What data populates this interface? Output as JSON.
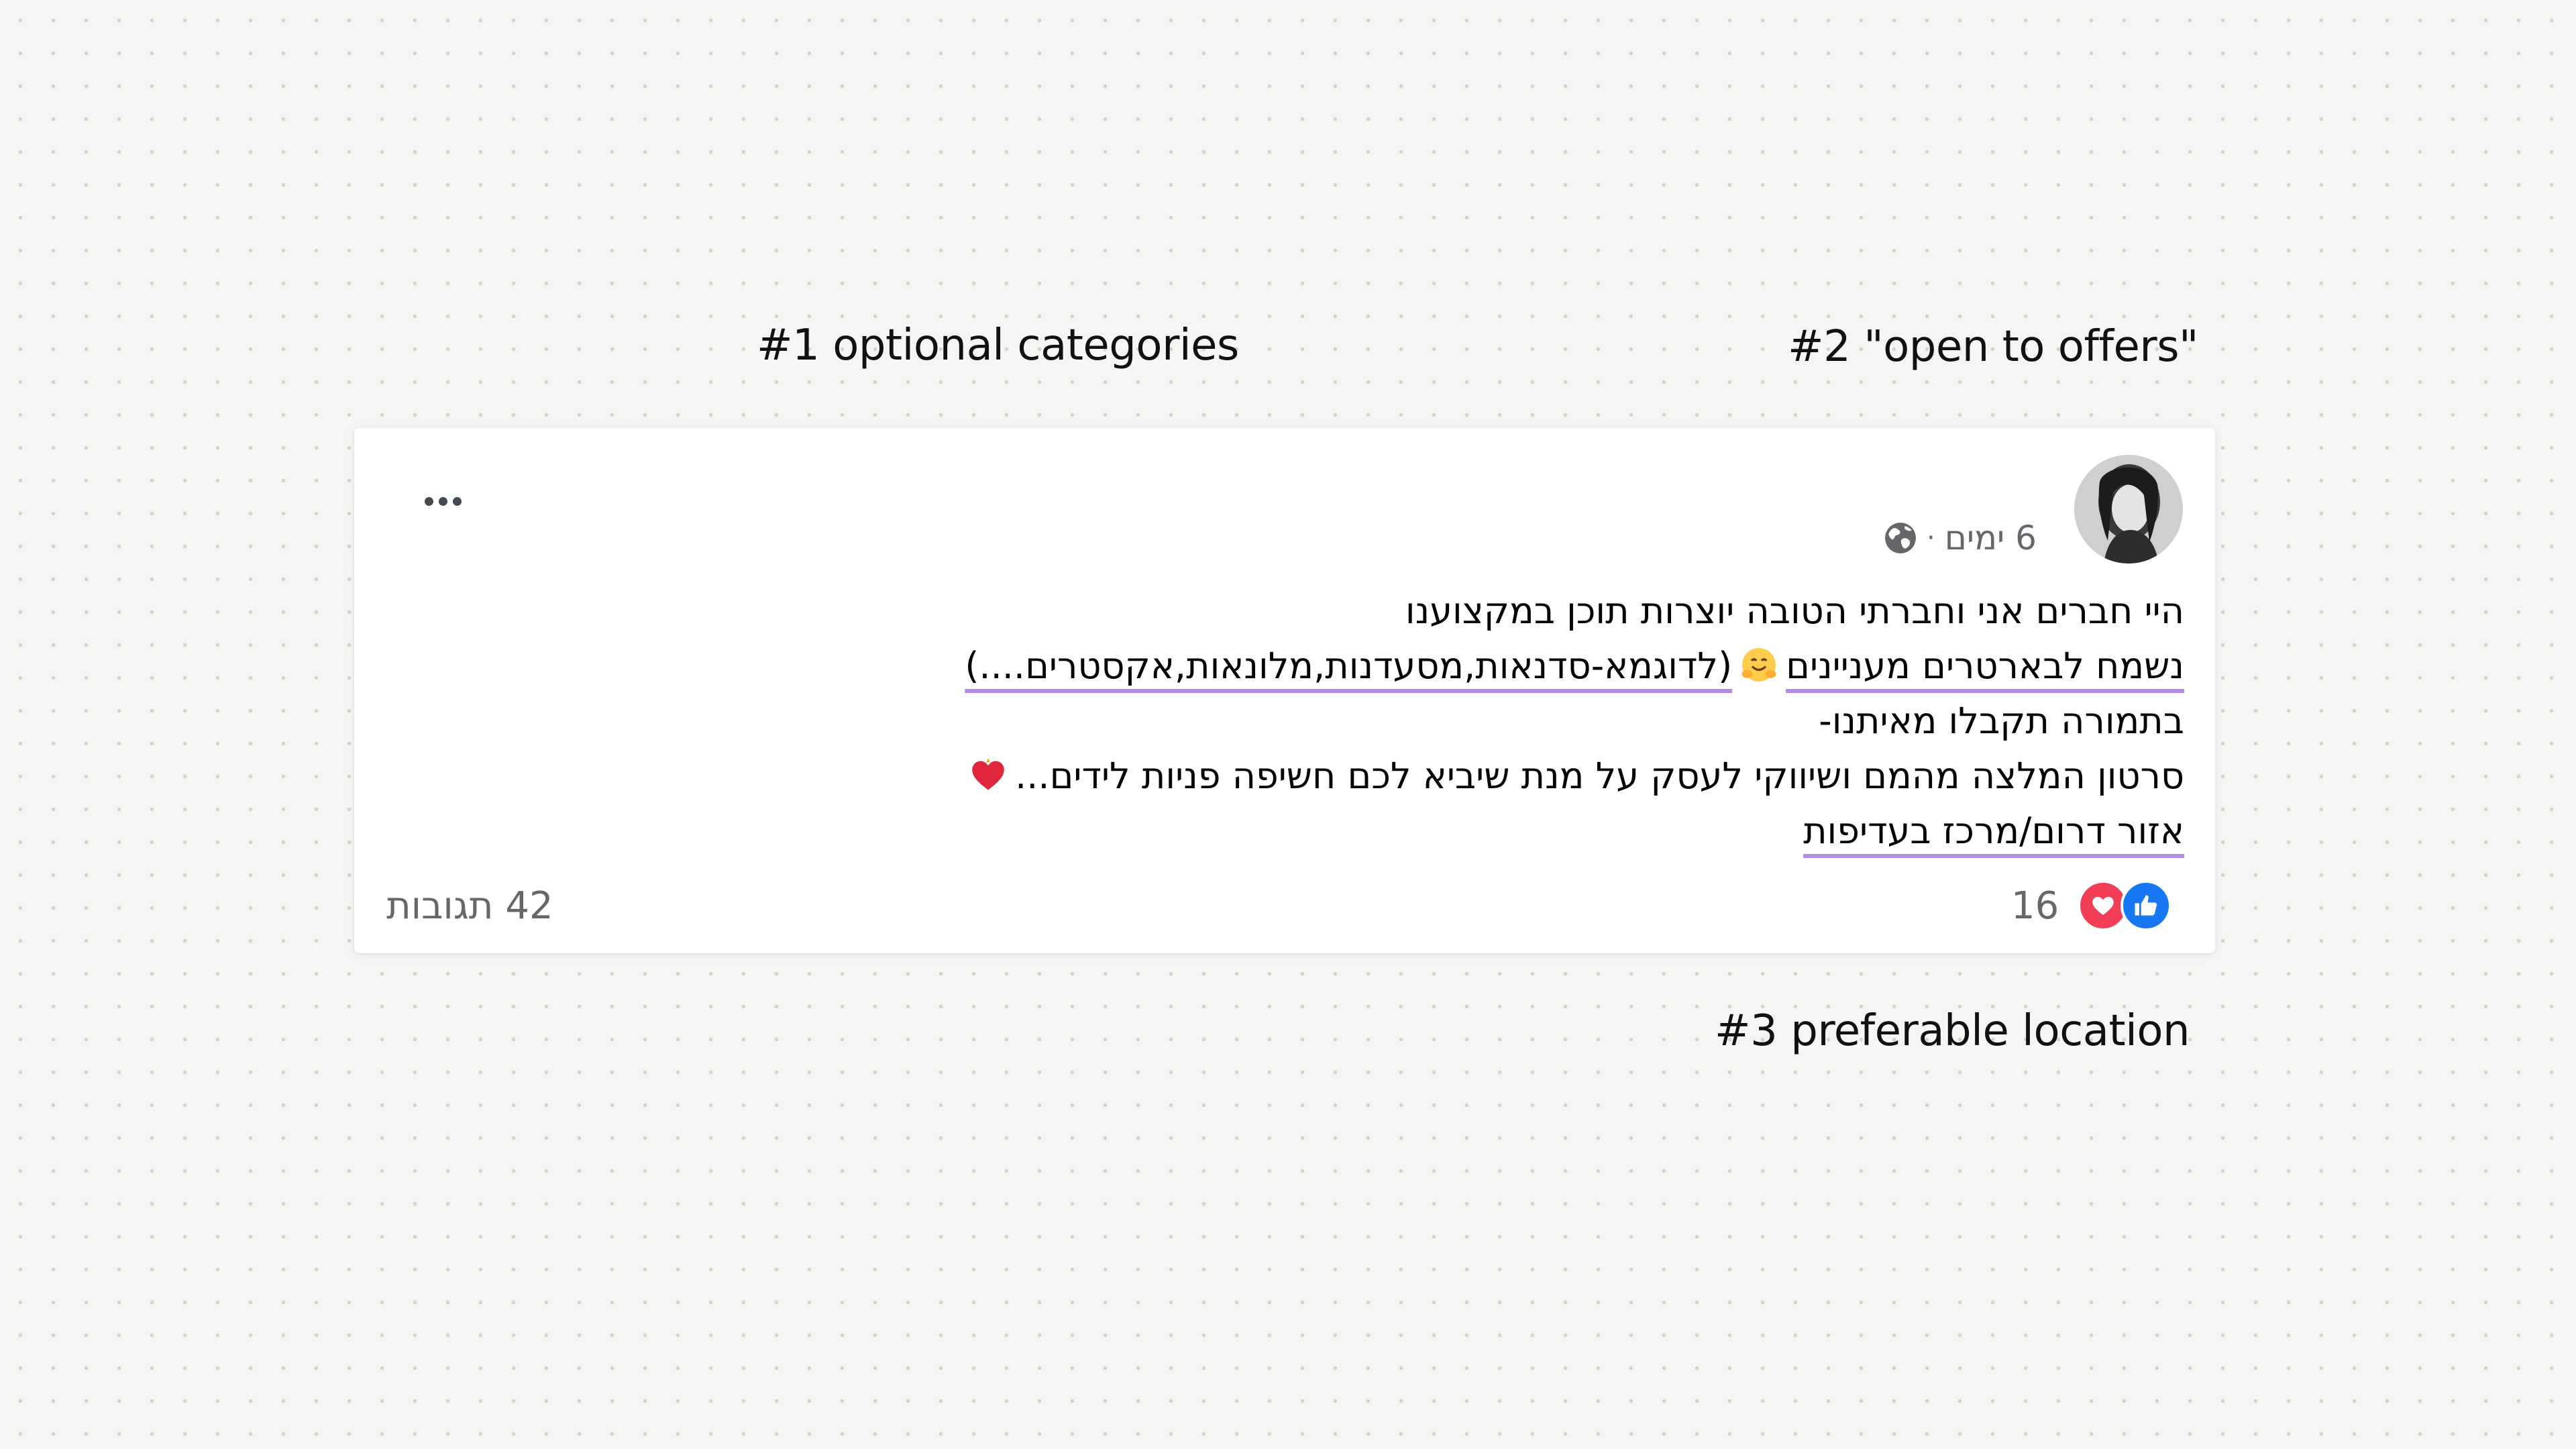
{
  "annotations": {
    "categories": "#1 optional categories",
    "offers": "#2 \"open to offers\"",
    "location": "#3 preferable location"
  },
  "post": {
    "time": "6 ימים",
    "separator": "·",
    "visibility_icon": "globe-icon",
    "lines": {
      "greeting": "היי חברים אני וחברתי הטובה יוצרות תוכן במקצוענו",
      "offer_text": "נשמח לבארטרים מעניינים",
      "emoji_name": "hugging-face-emoji",
      "categories_text": "(לדוגמא-סדנאות,מסעדנות,מלונאות,אקסטרים....)",
      "in_return": "בתמורה תקבלו מאיתנו-",
      "video_text": "סרטון המלצה מהמם ושיווקי לעסק על מנת שיביא לכם חשיפה פניות לידים...",
      "heart_emoji_name": "red-heart-emoji",
      "location_text": "אזור דרום/מרכז בעדיפות"
    },
    "reactions": {
      "count": "16",
      "types": [
        "like",
        "love"
      ],
      "like_color": "#1877f2",
      "love_color": "#f33e58"
    },
    "comments": "42 תגובות"
  },
  "colors": {
    "highlight_underline": "#b48ce6",
    "meta_text": "#65676b",
    "background": "#f6f5f4"
  }
}
